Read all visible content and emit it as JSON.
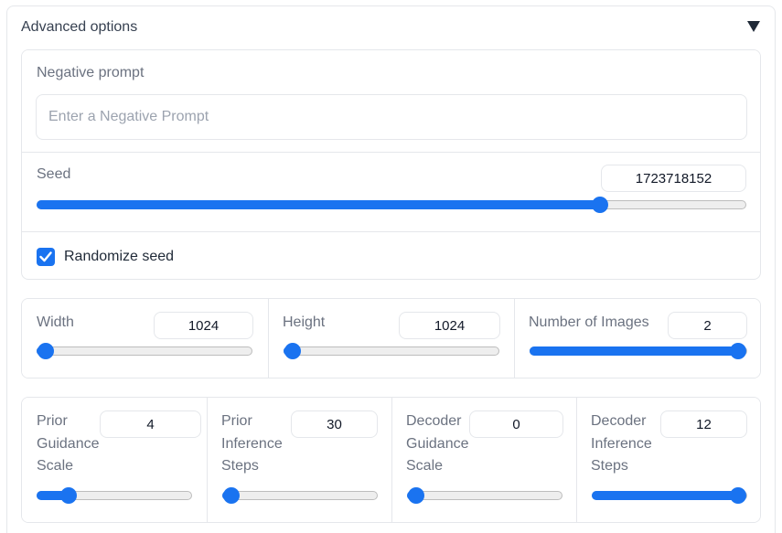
{
  "accordion": {
    "title": "Advanced options",
    "toggle_icon": "triangle-down-icon"
  },
  "negative_prompt": {
    "label": "Negative prompt",
    "value": "",
    "placeholder": "Enter a Negative Prompt"
  },
  "seed": {
    "label": "Seed",
    "value": "1723718152",
    "fraction": 0.795
  },
  "randomize_seed": {
    "label": "Randomize seed",
    "checked": true
  },
  "width": {
    "label": "Width",
    "value": "1024",
    "fraction": 0.0
  },
  "height": {
    "label": "Height",
    "value": "1024",
    "fraction": 0.0
  },
  "num_images": {
    "label": "Number of Images",
    "value": "2",
    "fraction": 1.0
  },
  "prior_guidance": {
    "label": "Prior Guidance Scale",
    "value": "4",
    "fraction": 0.2
  },
  "prior_steps": {
    "label": "Prior Inference Steps",
    "value": "30",
    "fraction": 0.0
  },
  "decoder_guidance": {
    "label": "Decoder Guidance Scale",
    "value": "0",
    "fraction": 0.0
  },
  "decoder_steps": {
    "label": "Decoder Inference Steps",
    "value": "12",
    "fraction": 1.0
  },
  "colors": {
    "accent": "#1a73f0",
    "border": "#e5e7eb",
    "label": "#6b7280"
  }
}
